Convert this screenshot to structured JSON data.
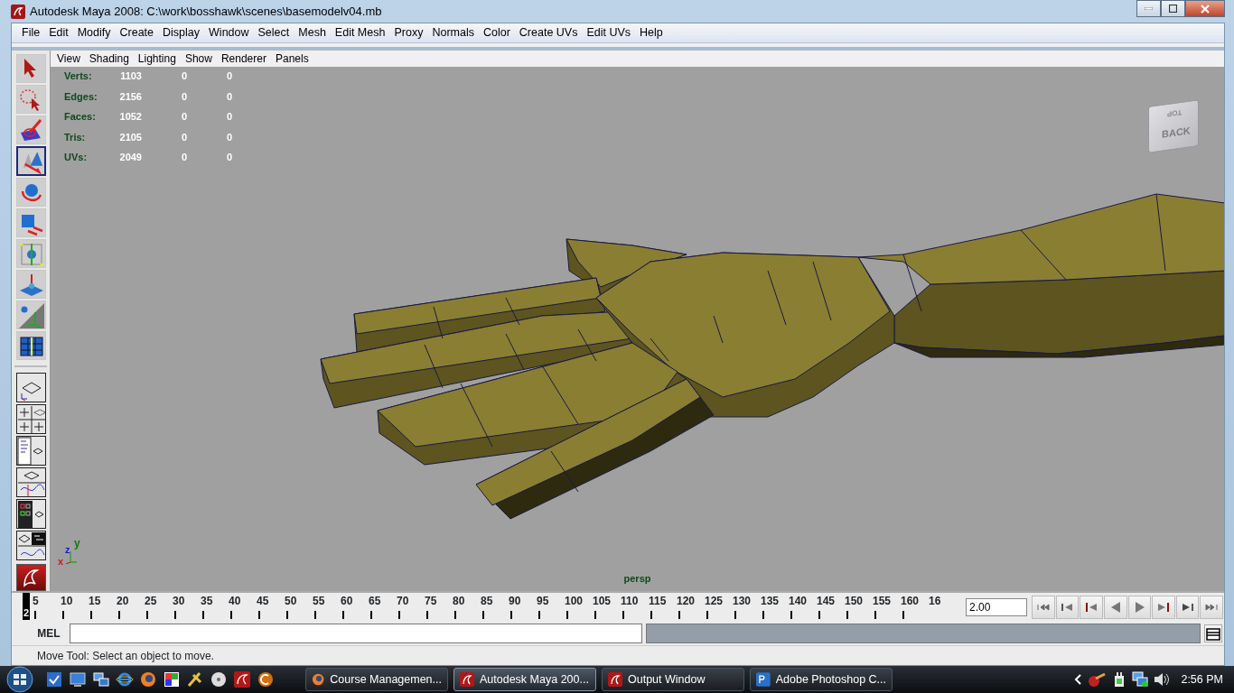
{
  "window": {
    "title": "Autodesk Maya 2008: C:\\work\\bosshawk\\scenes\\basemodelv04.mb"
  },
  "menu": [
    "File",
    "Edit",
    "Modify",
    "Create",
    "Display",
    "Window",
    "Select",
    "Mesh",
    "Edit Mesh",
    "Proxy",
    "Normals",
    "Color",
    "Create UVs",
    "Edit UVs",
    "Help"
  ],
  "tools": [
    {
      "kind": "select",
      "selected": false
    },
    {
      "kind": "lasso",
      "selected": false
    },
    {
      "kind": "paint",
      "selected": false
    },
    {
      "kind": "move",
      "selected": true
    },
    {
      "kind": "rotate",
      "selected": false
    },
    {
      "kind": "scale",
      "selected": false
    },
    {
      "kind": "manipulator",
      "selected": false
    },
    {
      "kind": "softmod",
      "selected": false
    },
    {
      "kind": "lastused",
      "selected": false
    },
    {
      "kind": "uvgrid",
      "selected": false
    }
  ],
  "layouts": [
    {
      "kind": "single"
    },
    {
      "kind": "four"
    },
    {
      "kind": "outliner"
    },
    {
      "kind": "graph"
    },
    {
      "kind": "hypershade"
    },
    {
      "kind": "trax"
    }
  ],
  "viewport": {
    "menu": [
      "View",
      "Shading",
      "Lighting",
      "Show",
      "Renderer",
      "Panels"
    ],
    "stats": [
      {
        "label": "Verts:",
        "values": [
          "1103",
          "0",
          "0"
        ]
      },
      {
        "label": "Edges:",
        "values": [
          "2156",
          "0",
          "0"
        ]
      },
      {
        "label": "Faces:",
        "values": [
          "1052",
          "0",
          "0"
        ]
      },
      {
        "label": "Tris:",
        "values": [
          "2105",
          "0",
          "0"
        ]
      },
      {
        "label": "UVs:",
        "values": [
          "2049",
          "0",
          "0"
        ]
      }
    ],
    "view_cube": {
      "top": "TOP",
      "front": "BACK"
    },
    "axis": {
      "x": "x",
      "y": "y",
      "z": "z"
    },
    "camera": "persp"
  },
  "timeline": {
    "current": "2",
    "labels": [
      "5",
      "10",
      "15",
      "20",
      "25",
      "30",
      "35",
      "40",
      "45",
      "50",
      "55",
      "60",
      "65",
      "70",
      "75",
      "80",
      "85",
      "90",
      "95",
      "100",
      "105",
      "110",
      "115",
      "120",
      "125",
      "130",
      "135",
      "140",
      "145",
      "150",
      "155",
      "160",
      "16"
    ],
    "frame_field": "2.00"
  },
  "playback": [
    {
      "kind": "first"
    },
    {
      "kind": "step-back-key"
    },
    {
      "kind": "step-back"
    },
    {
      "kind": "play-back"
    },
    {
      "kind": "play"
    },
    {
      "kind": "step-forward"
    },
    {
      "kind": "step-forward-key"
    },
    {
      "kind": "last"
    }
  ],
  "command_line": {
    "label": "MEL"
  },
  "help_line": "Move Tool: Select an object to move.",
  "taskbar": {
    "tasks": [
      {
        "label": "Course Managemen...",
        "kind": "browser",
        "selected": false
      },
      {
        "label": "Autodesk Maya 200...",
        "kind": "maya",
        "selected": true
      },
      {
        "label": "Output Window",
        "kind": "maya",
        "selected": false
      },
      {
        "label": "Adobe Photoshop C...",
        "kind": "photoshop",
        "selected": false
      }
    ],
    "clock": "2:56 PM"
  }
}
